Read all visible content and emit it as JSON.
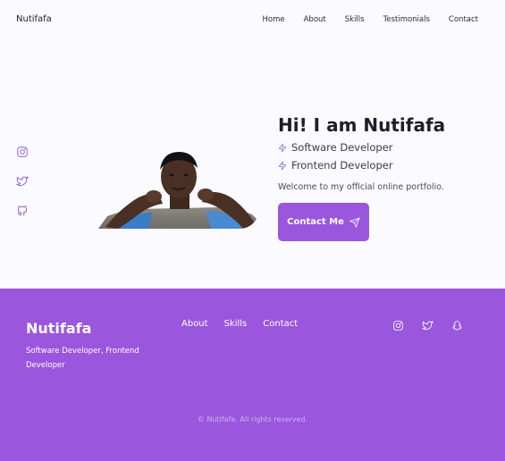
{
  "header": {
    "brand": "Nutifafa",
    "nav": [
      "Home",
      "About",
      "Skills",
      "Testimonials",
      "Contact"
    ]
  },
  "hero": {
    "title": "Hi! I am Nutifafa",
    "roles": [
      "Software Developer",
      "Frontend Developer"
    ],
    "welcome": "Welcome to my official online portfolio.",
    "cta": "Contact Me"
  },
  "social_icons": [
    "instagram-icon",
    "twitter-icon",
    "github-icon"
  ],
  "footer": {
    "brand": "Nutifafa",
    "tagline": "Software Developer, Frontend Developer",
    "nav": [
      "About",
      "Skills",
      "Contact"
    ],
    "social_icons": [
      "instagram-icon",
      "twitter-icon",
      "snapchat-icon"
    ],
    "copyright": "© Nutifafa. All rights reserved."
  },
  "colors": {
    "accent": "#9a56dd",
    "background": "#fbfaff"
  }
}
